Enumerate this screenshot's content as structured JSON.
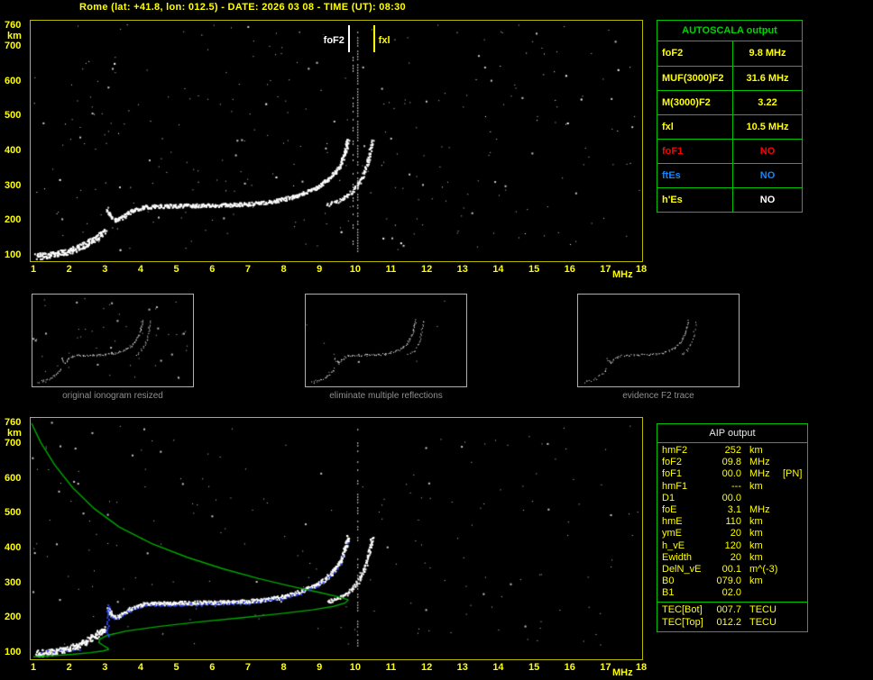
{
  "header": {
    "title": "Rome (lat: +41.8, lon: 012.5) - DATE: 2026 03 08 - TIME (UT): 08:30"
  },
  "colors": {
    "background": "#000000",
    "axis_yellow": "#ffff00",
    "frame_yellow": "#b9b900",
    "table_green": "#00c400",
    "trace_white": "#ffffff",
    "profile_green": "#00a800",
    "fit_blue": "#2c46ff",
    "noise_gray": "#c8c8c8",
    "caption_gray": "#8f8f8f"
  },
  "autoscala": {
    "title": "AUTOSCALA output",
    "rows": [
      {
        "label": "foF2",
        "value": "9.8 MHz",
        "label_color": "#ffff00",
        "value_color": "#ffff00"
      },
      {
        "label": "MUF(3000)F2",
        "value": "31.6 MHz",
        "label_color": "#ffff00",
        "value_color": "#ffff00"
      },
      {
        "label": "M(3000)F2",
        "value": "3.22",
        "label_color": "#ffff00",
        "value_color": "#ffff00"
      },
      {
        "label": "fxl",
        "value": "10.5 MHz",
        "label_color": "#ffff00",
        "value_color": "#ffff00"
      },
      {
        "label": "foF1",
        "value": "NO",
        "label_color": "#ff0000",
        "value_color": "#ff0000"
      },
      {
        "label": "ftEs",
        "value": "NO",
        "label_color": "#0f86ff",
        "value_color": "#0f86ff"
      },
      {
        "label": "h'Es",
        "value": "NO",
        "label_color": "#ffff00",
        "value_color": "#ffffff"
      }
    ]
  },
  "aip": {
    "title": "AIP output",
    "rows": [
      {
        "name": "hmF2",
        "value": "252",
        "unit": "km",
        "extra": ""
      },
      {
        "name": "foF2",
        "value": "09.8",
        "unit": "MHz",
        "extra": ""
      },
      {
        "name": "foF1",
        "value": "00.0",
        "unit": "MHz",
        "extra": "[PN]"
      },
      {
        "name": "hmF1",
        "value": "---",
        "unit": "km",
        "extra": ""
      },
      {
        "name": "D1",
        "value": "00.0",
        "unit": "",
        "extra": ""
      },
      {
        "name": "foE",
        "value": "3.1",
        "unit": "MHz",
        "extra": ""
      },
      {
        "name": "hmE",
        "value": "110",
        "unit": "km",
        "extra": ""
      },
      {
        "name": "ymE",
        "value": "20",
        "unit": "km",
        "extra": ""
      },
      {
        "name": "h_vE",
        "value": "120",
        "unit": "km",
        "extra": ""
      },
      {
        "name": "Ewidth",
        "value": "20",
        "unit": "km",
        "extra": ""
      },
      {
        "name": "DelN_vE",
        "value": "00.1",
        "unit": "m^(-3)",
        "extra": ""
      },
      {
        "name": "B0",
        "value": "079.0",
        "unit": "km",
        "extra": ""
      },
      {
        "name": "B1",
        "value": "02.0",
        "unit": "",
        "extra": ""
      }
    ],
    "tec_rows": [
      {
        "name": "TEC[Bot]",
        "value": "007.7",
        "unit": "TECU",
        "extra": ""
      },
      {
        "name": "TEC[Top]",
        "value": "012.2",
        "unit": "TECU",
        "extra": ""
      }
    ]
  },
  "thumbnails": [
    {
      "caption": "original ionogram resized"
    },
    {
      "caption": "eliminate multiple reflections"
    },
    {
      "caption": "evidence F2 trace"
    }
  ],
  "chart_data": [
    {
      "type": "scatter",
      "title": "recorded ionogram",
      "xlabel": "MHz",
      "ylabel": "km",
      "xlim": [
        1,
        18
      ],
      "ylim": [
        100,
        760
      ],
      "x_ticks": [
        1,
        2,
        3,
        4,
        5,
        6,
        7,
        8,
        9,
        10,
        11,
        12,
        13,
        14,
        15,
        16,
        17,
        18
      ],
      "y_ticks": [
        760,
        700,
        600,
        500,
        400,
        300,
        200,
        100
      ],
      "grid": false,
      "annotations": [
        {
          "label": "foF2",
          "freq_mhz": 9.8,
          "color": "#ffffff"
        },
        {
          "label": "fxl",
          "freq_mhz": 10.5,
          "color": "#ffff00"
        }
      ],
      "series": [
        {
          "name": "E-Es echo",
          "points": [
            [
              1.05,
              100
            ],
            [
              1.35,
              103
            ],
            [
              1.65,
              107
            ],
            [
              1.95,
              113
            ],
            [
              2.2,
              122
            ],
            [
              2.45,
              134
            ],
            [
              2.7,
              150
            ],
            [
              2.9,
              164
            ],
            [
              3.0,
              172
            ]
          ]
        },
        {
          "name": "F o-mode echo",
          "points": [
            [
              3.05,
              232
            ],
            [
              3.15,
              215
            ],
            [
              3.3,
              203
            ],
            [
              3.45,
              210
            ],
            [
              3.6,
              222
            ],
            [
              3.8,
              233
            ],
            [
              4.1,
              242
            ],
            [
              4.5,
              244
            ],
            [
              5.0,
              245
            ],
            [
              5.5,
              246
            ],
            [
              6.0,
              247
            ],
            [
              6.5,
              248
            ],
            [
              7.0,
              250
            ],
            [
              7.4,
              254
            ],
            [
              7.8,
              260
            ],
            [
              8.1,
              267
            ],
            [
              8.4,
              276
            ],
            [
              8.7,
              288
            ],
            [
              8.95,
              300
            ],
            [
              9.15,
              315
            ],
            [
              9.35,
              333
            ],
            [
              9.5,
              352
            ],
            [
              9.6,
              371
            ],
            [
              9.68,
              392
            ],
            [
              9.74,
              415
            ],
            [
              9.78,
              438
            ]
          ]
        },
        {
          "name": "F x-mode echo",
          "points": [
            [
              9.2,
              248
            ],
            [
              9.5,
              258
            ],
            [
              9.75,
              272
            ],
            [
              9.95,
              290
            ],
            [
              10.1,
              312
            ],
            [
              10.22,
              338
            ],
            [
              10.32,
              368
            ],
            [
              10.4,
              400
            ],
            [
              10.46,
              435
            ]
          ]
        }
      ]
    },
    {
      "type": "scatter",
      "title": "ionogram with fitted trace and electron density profile",
      "xlabel": "MHz",
      "ylabel": "km",
      "xlim": [
        1,
        18
      ],
      "ylim": [
        100,
        760
      ],
      "x_ticks": [
        1,
        2,
        3,
        4,
        5,
        6,
        7,
        8,
        9,
        10,
        11,
        12,
        13,
        14,
        15,
        16,
        17,
        18
      ],
      "y_ticks": [
        760,
        700,
        600,
        500,
        400,
        300,
        200,
        100
      ],
      "grid": false,
      "fit_overlay": {
        "color": "#2c46ff",
        "range_mhz": [
          3.0,
          9.77
        ]
      },
      "series": [
        {
          "name": "E-Es echo",
          "points": [
            [
              1.05,
              100
            ],
            [
              1.35,
              103
            ],
            [
              1.65,
              107
            ],
            [
              1.95,
              113
            ],
            [
              2.2,
              122
            ],
            [
              2.45,
              134
            ],
            [
              2.7,
              150
            ],
            [
              2.9,
              164
            ],
            [
              3.0,
              172
            ]
          ]
        },
        {
          "name": "F o-mode echo",
          "points": [
            [
              3.05,
              232
            ],
            [
              3.15,
              215
            ],
            [
              3.3,
              203
            ],
            [
              3.45,
              210
            ],
            [
              3.6,
              222
            ],
            [
              3.8,
              233
            ],
            [
              4.1,
              242
            ],
            [
              4.5,
              244
            ],
            [
              5.0,
              245
            ],
            [
              5.5,
              246
            ],
            [
              6.0,
              247
            ],
            [
              6.5,
              248
            ],
            [
              7.0,
              250
            ],
            [
              7.4,
              254
            ],
            [
              7.8,
              260
            ],
            [
              8.1,
              267
            ],
            [
              8.4,
              276
            ],
            [
              8.7,
              288
            ],
            [
              8.95,
              300
            ],
            [
              9.15,
              315
            ],
            [
              9.35,
              333
            ],
            [
              9.5,
              352
            ],
            [
              9.6,
              371
            ],
            [
              9.68,
              392
            ],
            [
              9.74,
              415
            ],
            [
              9.78,
              438
            ]
          ]
        },
        {
          "name": "F x-mode echo",
          "points": [
            [
              9.2,
              248
            ],
            [
              9.5,
              258
            ],
            [
              9.75,
              272
            ],
            [
              9.95,
              290
            ],
            [
              10.1,
              312
            ],
            [
              10.22,
              338
            ],
            [
              10.32,
              368
            ],
            [
              10.4,
              400
            ],
            [
              10.46,
              435
            ]
          ]
        },
        {
          "name": "electron density profile",
          "points": [
            [
              0.95,
              760
            ],
            [
              1.2,
              706
            ],
            [
              1.6,
              640
            ],
            [
              2.1,
              575
            ],
            [
              2.7,
              515
            ],
            [
              3.4,
              462
            ],
            [
              4.3,
              415
            ],
            [
              5.3,
              375
            ],
            [
              6.3,
              342
            ],
            [
              7.3,
              314
            ],
            [
              8.2,
              292
            ],
            [
              9.0,
              274
            ],
            [
              9.5,
              262
            ],
            [
              9.78,
              254
            ],
            [
              9.8,
              252
            ],
            [
              9.72,
              244
            ],
            [
              9.4,
              234
            ],
            [
              8.8,
              224
            ],
            [
              7.9,
              213
            ],
            [
              6.8,
              201
            ],
            [
              5.6,
              189
            ],
            [
              4.5,
              176
            ],
            [
              3.6,
              163
            ],
            [
              3.05,
              150
            ],
            [
              2.85,
              139
            ],
            [
              2.83,
              130
            ],
            [
              2.95,
              122
            ],
            [
              3.08,
              114
            ],
            [
              3.1,
              110
            ],
            [
              2.95,
              106
            ],
            [
              2.6,
              101
            ],
            [
              2.1,
              96
            ],
            [
              1.5,
              92
            ],
            [
              1.0,
              89
            ]
          ]
        }
      ]
    }
  ]
}
